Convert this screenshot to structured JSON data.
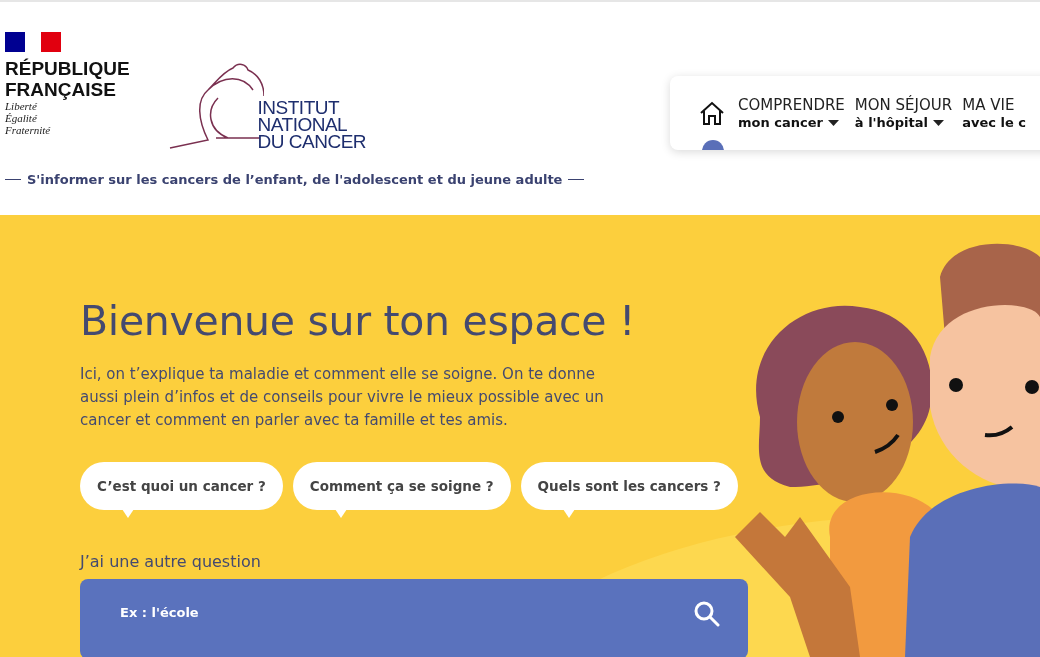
{
  "header": {
    "gov_logo": {
      "lines": [
        "RÉPUBLIQUE",
        "FRANÇAISE"
      ],
      "motto": [
        "Liberté",
        "Égalité",
        "Fraternité"
      ]
    },
    "inca_logo": {
      "lines": [
        "INSTITUT",
        "NATIONAL",
        "DU CANCER"
      ]
    },
    "tagline": "S'informer sur les cancers de l’enfant, de l'adolescent et du jeune adulte"
  },
  "nav": {
    "home_selected": true,
    "items": [
      {
        "top": "COMPRENDRE",
        "bottom": "mon cancer",
        "has_menu": true
      },
      {
        "top": "MON SÉJOUR",
        "bottom": "à l'hôpital",
        "has_menu": true
      },
      {
        "top": "MA VIE",
        "bottom": "avec le c",
        "has_menu": false
      }
    ]
  },
  "hero": {
    "title": "Bienvenue sur ton espace !",
    "intro": "Ici, on t’explique ta maladie et comment elle se soigne. On te donne aussi plein d’infos et de conseils pour vivre le mieux possible avec un cancer et comment en parler avec ta famille et tes amis.",
    "questions": [
      "C’est quoi un cancer ?",
      "Comment ça se soigne ?",
      "Quels sont les cancers ?"
    ],
    "search_label": "J’ai une autre question",
    "search": {
      "placeholder": "Ex : l'école"
    }
  }
}
